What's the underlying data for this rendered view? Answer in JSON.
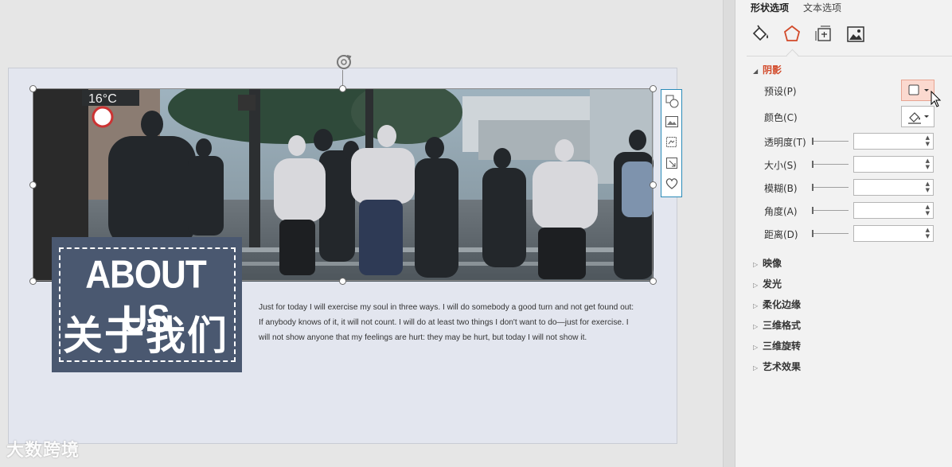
{
  "slide": {
    "title_en": "ABOUT US",
    "title_cn": "关于我们",
    "body_lines": [
      "Just for today I will exercise my soul in three ways. I will do somebody a good turn and not get found out:",
      "If anybody knows of it, it will not count. I will do at least two things I don't want to do—just for exercise. I",
      "will not show anyone that my feelings are hurt: they may be hurt, but today I will not show it."
    ],
    "photo_sign_temp": "16°C"
  },
  "float_toolbar": {
    "icons": [
      "layout-options-icon",
      "picture-icon",
      "crop-icon",
      "resize-icon",
      "favorite-heart-icon"
    ]
  },
  "watermark": "大数跨境",
  "pane": {
    "tabs": [
      {
        "label": "形状选项",
        "active": true
      },
      {
        "label": "文本选项",
        "active": false
      }
    ],
    "icon_tabs": [
      "fill-line-icon",
      "effects-pentagon-icon",
      "size-properties-icon",
      "picture-icon"
    ],
    "shadow": {
      "heading": "阴影",
      "preset_label": "预设(P)",
      "color_label": "颜色(C)",
      "rows": [
        {
          "label": "透明度(T)",
          "value": ""
        },
        {
          "label": "大小(S)",
          "value": ""
        },
        {
          "label": "模糊(B)",
          "value": ""
        },
        {
          "label": "角度(A)",
          "value": ""
        },
        {
          "label": "距离(D)",
          "value": ""
        }
      ]
    },
    "sections": [
      "映像",
      "发光",
      "柔化边缘",
      "三维格式",
      "三维旋转",
      "艺术效果"
    ]
  },
  "colors": {
    "accent": "#d24a2a",
    "title_box": "#4a5870",
    "slide_bg": "#e3e6ef",
    "toolbar_border": "#2a8bb8"
  }
}
